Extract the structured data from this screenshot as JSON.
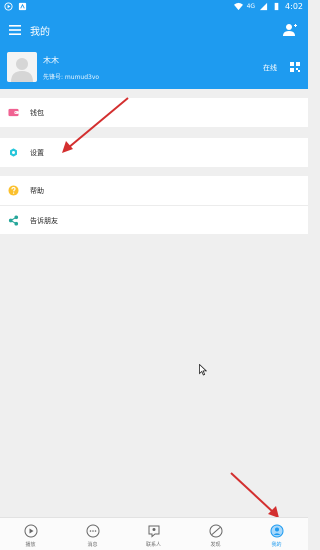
{
  "status_bar": {
    "time": "4:02",
    "network": "4G"
  },
  "app_bar": {
    "title": "我的"
  },
  "profile": {
    "name": "木木",
    "account": "先锋号: mumud3vo",
    "status": "在线"
  },
  "menu_groups": [
    {
      "items": [
        {
          "label": "钱包",
          "icon": "wallet-icon",
          "color": "#f06292"
        }
      ]
    },
    {
      "items": [
        {
          "label": "设置",
          "icon": "gear-icon",
          "color": "#26c6da"
        }
      ]
    },
    {
      "items": [
        {
          "label": "帮助",
          "icon": "help-icon",
          "color": "#fbc02d"
        },
        {
          "label": "告诉朋友",
          "icon": "share-icon",
          "color": "#26a69a"
        }
      ]
    }
  ],
  "bottom_nav": [
    {
      "label": "播放",
      "icon": "play-icon"
    },
    {
      "label": "消息",
      "icon": "message-icon"
    },
    {
      "label": "联系人",
      "icon": "contacts-icon"
    },
    {
      "label": "发现",
      "icon": "discover-icon"
    },
    {
      "label": "我的",
      "icon": "me-icon",
      "active": true
    }
  ],
  "colors": {
    "accent": "#1e9bf0",
    "annotation": "#d32f2f",
    "background": "#efefef"
  }
}
